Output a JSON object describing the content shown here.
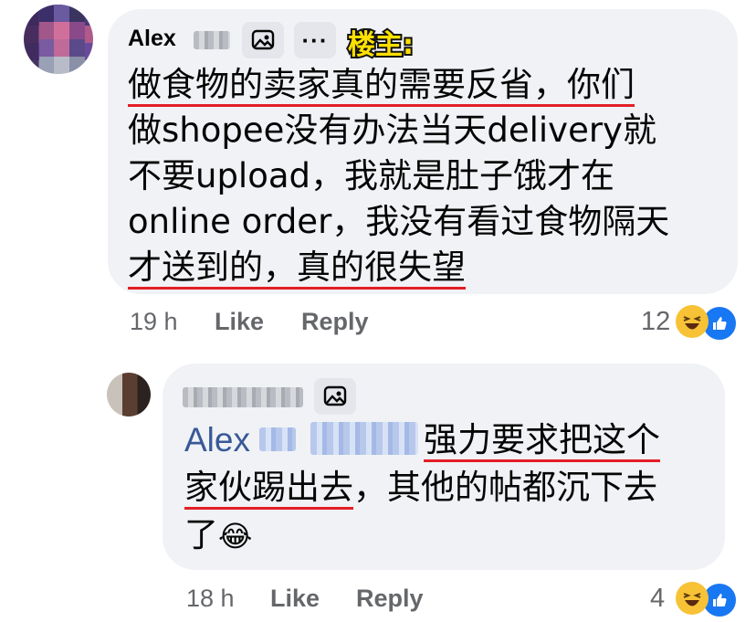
{
  "comment1": {
    "author_first": "Alex",
    "op_badge": "楼主:",
    "more_label": "···",
    "text_lines": [
      "做食物的卖家真的需要反省，你们",
      "做shopee没有办法当天delivery就",
      "不要upload，我就是肚子饿才在",
      "online order，我没有看过食物隔天",
      "才送到的，真的很失望"
    ],
    "time": "19 h",
    "like_label": "Like",
    "reply_label": "Reply",
    "reaction_count": "12"
  },
  "comment2": {
    "mention_first": "Alex",
    "text_line1": "强力要求把这个",
    "text_line2_a": "家伙踢出去",
    "text_line2_b": "，其他的帖都沉下去",
    "text_line3": "了",
    "emoji": "😂",
    "time": "18 h",
    "like_label": "Like",
    "reply_label": "Reply",
    "reaction_count": "4"
  },
  "icons": [
    "sticker-icon",
    "more-icon",
    "haha-icon",
    "like-icon"
  ],
  "colors": {
    "bubble": "#f0f2f5",
    "meta": "#65676b",
    "mention": "#385898",
    "underline": "#e41e26",
    "op_badge": "#ffe000"
  }
}
